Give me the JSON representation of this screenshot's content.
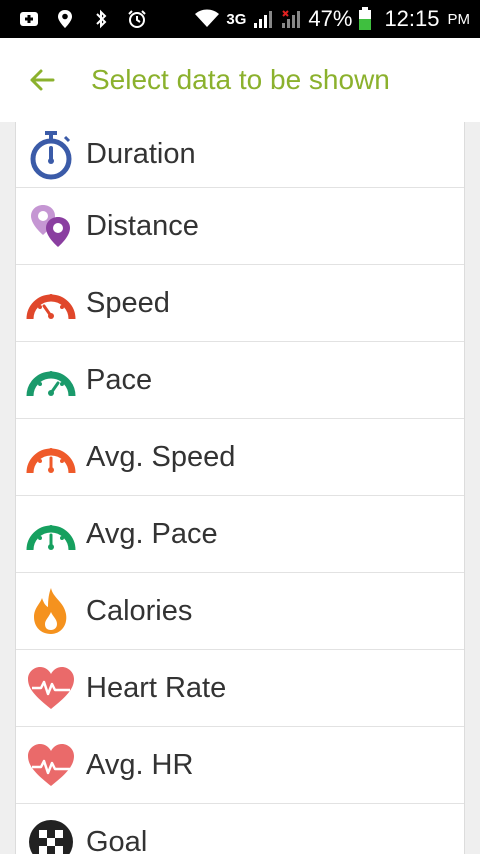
{
  "status_bar": {
    "battery_percent": "47%",
    "time": "12:15",
    "ampm": "PM",
    "network": "3G",
    "icons": [
      "notification-icon",
      "location-icon",
      "bluetooth-icon",
      "alarm-icon",
      "wifi-icon",
      "signal-icon",
      "signal-no-icon",
      "battery-icon"
    ]
  },
  "app_bar": {
    "title": "Select data to be shown",
    "back_icon": "arrow-left-icon"
  },
  "colors": {
    "accent": "#8bb12d",
    "duration": "#3b5ba8",
    "distance": "#9b4fb0",
    "speed": "#e0472b",
    "pace": "#1a9a6b",
    "avg_speed": "#ef5a2a",
    "avg_pace": "#16a05f",
    "calories": "#f5921e",
    "heart": "#ea6a6a",
    "goal": "#222222"
  },
  "items": [
    {
      "label": "Duration",
      "icon": "stopwatch-icon"
    },
    {
      "label": "Distance",
      "icon": "map-pin-icon"
    },
    {
      "label": "Speed",
      "icon": "speedometer-icon"
    },
    {
      "label": "Pace",
      "icon": "speedometer-icon"
    },
    {
      "label": "Avg. Speed",
      "icon": "avg-speedometer-icon"
    },
    {
      "label": "Avg. Pace",
      "icon": "avg-speedometer-icon"
    },
    {
      "label": "Calories",
      "icon": "flame-icon"
    },
    {
      "label": "Heart Rate",
      "icon": "heart-pulse-icon"
    },
    {
      "label": "Avg. HR",
      "icon": "heart-pulse-icon"
    },
    {
      "label": "Goal",
      "icon": "checkered-flag-icon"
    }
  ]
}
